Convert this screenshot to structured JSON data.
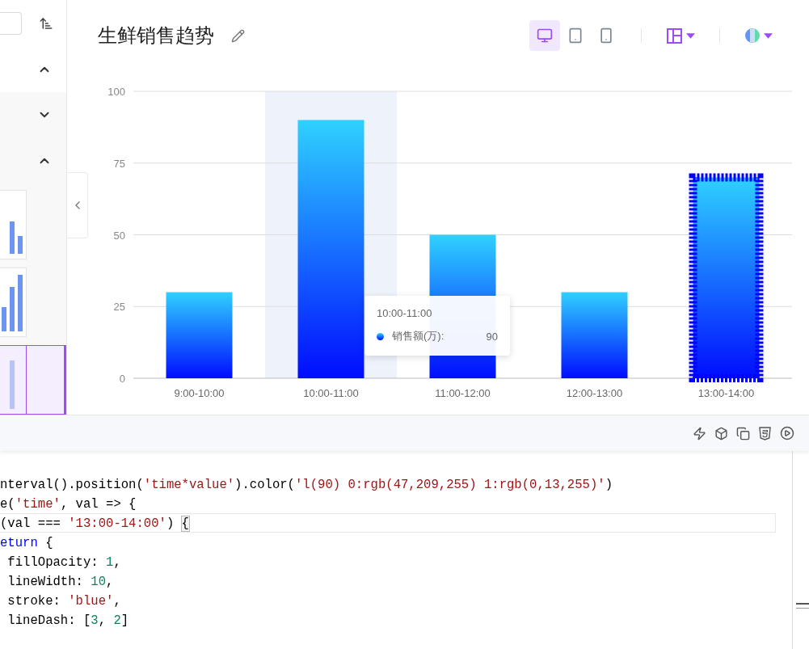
{
  "sidebar": {
    "sections": [
      {
        "expanded": true
      },
      {
        "expanded": false
      },
      {
        "expanded": true
      }
    ],
    "thumbnails": [
      {
        "selected": false
      },
      {
        "selected": false
      },
      {
        "selected": true
      }
    ]
  },
  "header": {
    "title": "生鲜销售趋势",
    "devices": [
      {
        "kind": "desktop",
        "selected": true
      },
      {
        "kind": "tablet",
        "selected": false
      },
      {
        "kind": "phone",
        "selected": false
      }
    ]
  },
  "chart": {
    "chart_data": {
      "type": "bar",
      "categories": [
        "9:00-10:00",
        "10:00-11:00",
        "11:00-12:00",
        "12:00-13:00",
        "13:00-14:00"
      ],
      "series": [
        {
          "color": "#000dff",
          "values": [
            30,
            90,
            50,
            30,
            70
          ]
        }
      ],
      "ylim": [
        0,
        100
      ],
      "yticks": [
        0,
        25,
        50,
        75,
        100
      ],
      "grid": true
    },
    "hovered": [
      false,
      true,
      false,
      false,
      false
    ],
    "stroked": [
      false,
      false,
      false,
      false,
      true
    ],
    "tooltip": {
      "title": "10:00-11:00",
      "label": "销售额(万):",
      "value": "90"
    }
  },
  "editor": {
    "lines": [
      {
        "current": false,
        "tokens": [
          {
            "kind": "plain",
            "text": "nterval().position("
          },
          {
            "kind": "string",
            "text": "'time*value'"
          },
          {
            "kind": "plain",
            "text": ").color("
          },
          {
            "kind": "string",
            "text": "'l(90) 0:rgb(47,209,255) 1:rgb(0,13,255)'"
          },
          {
            "kind": "plain",
            "text": ")"
          }
        ]
      },
      {
        "current": false,
        "tokens": [
          {
            "kind": "plain",
            "text": "e("
          },
          {
            "kind": "string",
            "text": "'time'"
          },
          {
            "kind": "plain",
            "text": ", val => {"
          }
        ]
      },
      {
        "current": true,
        "tokens": [
          {
            "kind": "plain",
            "text": "(val === "
          },
          {
            "kind": "string",
            "text": "'13:00-14:00'"
          },
          {
            "kind": "plain",
            "text": ") "
          },
          {
            "kind": "bracket",
            "text": "{"
          }
        ]
      },
      {
        "current": false,
        "tokens": [
          {
            "kind": "keyword",
            "text": "eturn"
          },
          {
            "kind": "plain",
            "text": " {"
          }
        ]
      },
      {
        "current": false,
        "tokens": [
          {
            "kind": "plain",
            "text": " fillOpacity: "
          },
          {
            "kind": "number",
            "text": "1"
          },
          {
            "kind": "plain",
            "text": ","
          }
        ]
      },
      {
        "current": false,
        "tokens": [
          {
            "kind": "plain",
            "text": " lineWidth: "
          },
          {
            "kind": "number",
            "text": "10"
          },
          {
            "kind": "plain",
            "text": ","
          }
        ]
      },
      {
        "current": false,
        "tokens": [
          {
            "kind": "plain",
            "text": " stroke: "
          },
          {
            "kind": "string",
            "text": "'blue'"
          },
          {
            "kind": "plain",
            "text": ","
          }
        ]
      },
      {
        "current": false,
        "tokens": [
          {
            "kind": "plain",
            "text": " lineDash: ["
          },
          {
            "kind": "number",
            "text": "3"
          },
          {
            "kind": "plain",
            "text": ", "
          },
          {
            "kind": "number",
            "text": "2"
          },
          {
            "kind": "plain",
            "text": "]"
          }
        ]
      }
    ]
  }
}
